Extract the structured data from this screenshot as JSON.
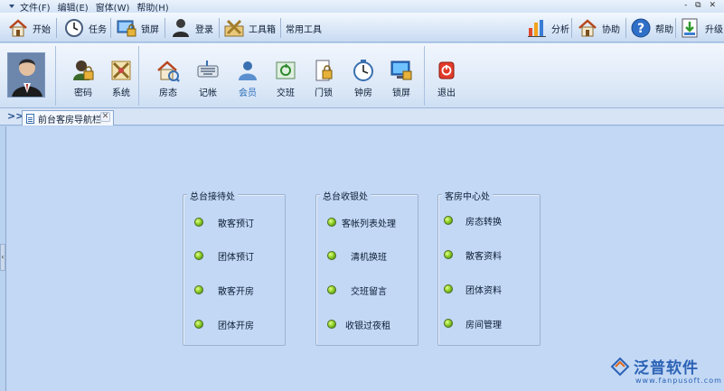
{
  "menu": {
    "items": [
      "文件(F)",
      "编辑(E)",
      "窗体(W)",
      "帮助(H)"
    ],
    "window_controls": "- ⧉ ✕"
  },
  "quickbar": {
    "left": [
      {
        "label": "开始",
        "icon": "home-icon"
      },
      {
        "label": "任务",
        "icon": "clock-icon"
      },
      {
        "label": "锁屏",
        "icon": "lock-screen-icon"
      },
      {
        "label": "登录",
        "icon": "user-login-icon"
      },
      {
        "label": "工具箱",
        "icon": "toolbox-icon"
      },
      {
        "label": "常用工具",
        "icon": ""
      }
    ],
    "right": [
      {
        "label": "分析",
        "icon": "bar-chart-icon"
      },
      {
        "label": "协助",
        "icon": "home-icon"
      },
      {
        "label": "帮助",
        "icon": "help-icon"
      },
      {
        "label": "升级",
        "icon": "download-icon"
      }
    ]
  },
  "ribbon": {
    "group1": [
      {
        "label": "密码",
        "icon": "password-icon"
      },
      {
        "label": "系统",
        "icon": "system-tools-icon"
      }
    ],
    "group2": [
      {
        "label": "房态",
        "icon": "room-status-icon"
      },
      {
        "label": "记帐",
        "icon": "keyboard-icon"
      },
      {
        "label": "会员",
        "icon": "member-icon"
      },
      {
        "label": "交班",
        "icon": "shift-handover-icon"
      },
      {
        "label": "门锁",
        "icon": "door-lock-icon"
      },
      {
        "label": "钟房",
        "icon": "clock-room-icon"
      },
      {
        "label": "锁屏",
        "icon": "lock-screen-icon"
      }
    ],
    "group3": [
      {
        "label": "退出",
        "icon": "power-exit-icon"
      }
    ]
  },
  "tabs": {
    "chevron": ">>",
    "active_label": "前台客房导航栏",
    "close": "✕"
  },
  "panels": [
    {
      "title": "总台接待处",
      "items": [
        "散客预订",
        "团体预订",
        "散客开房",
        "团体开房"
      ]
    },
    {
      "title": "总台收银处",
      "items": [
        "客帐列表处理",
        "清机换班",
        "交班留言",
        "收银过夜租"
      ]
    },
    {
      "title": "客房中心处",
      "items": [
        "房态转换",
        "散客资料",
        "团体资料",
        "房间管理"
      ]
    }
  ],
  "watermark": {
    "brand": "泛普软件",
    "url": "www.fanpusoft.com"
  },
  "colors": {
    "accent": "#2a6db8",
    "background": "#c2d8f4",
    "led": "#8fd02a",
    "watermark": "#2b62b5"
  }
}
